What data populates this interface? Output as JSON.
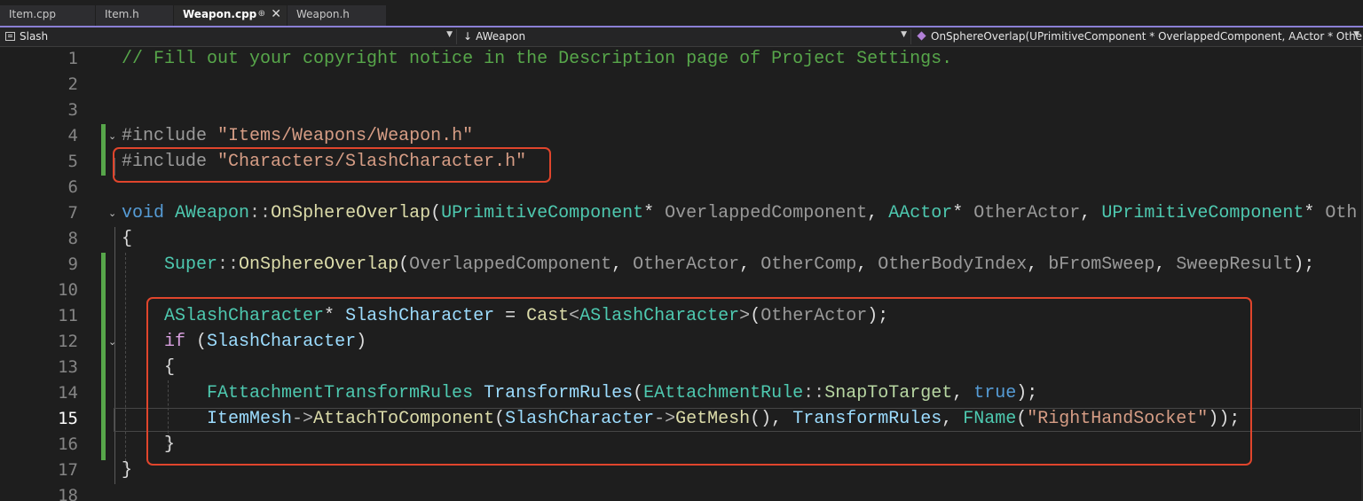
{
  "tabs": [
    {
      "label": "Item.cpp"
    },
    {
      "label": "Item.h"
    },
    {
      "label": "Weapon.cpp"
    },
    {
      "label": "Weapon.h"
    }
  ],
  "nav": {
    "project": "Slash",
    "scope": "AWeapon",
    "member": "OnSphereOverlap(UPrimitiveComponent * OverlappedComponent, AActor * Othe"
  },
  "current_line": 15,
  "lines": [
    {
      "num": "1",
      "tokens": [
        [
          "// Fill out your copyright notice in the Description page of Project Settings.",
          "cm"
        ]
      ]
    },
    {
      "num": "2",
      "tokens": []
    },
    {
      "num": "3",
      "tokens": []
    },
    {
      "num": "4",
      "tokens": [
        [
          "#include ",
          "pp"
        ],
        [
          "\"Items/Weapons/Weapon.h\"",
          "st"
        ]
      ]
    },
    {
      "num": "5",
      "tokens": [
        [
          "#include ",
          "pp"
        ],
        [
          "\"Characters/SlashCharacter.h\"",
          "st"
        ]
      ]
    },
    {
      "num": "6",
      "tokens": []
    },
    {
      "num": "7",
      "tokens": [
        [
          "void",
          "kw"
        ],
        [
          " ",
          ""
        ],
        [
          "AWeapon",
          "ty"
        ],
        [
          "::",
          "op"
        ],
        [
          "OnSphereOverlap",
          "fn"
        ],
        [
          "(",
          ""
        ],
        [
          "UPrimitiveComponent",
          "ty"
        ],
        [
          "* ",
          ""
        ],
        [
          "OverlappedComponent",
          "pm"
        ],
        [
          ", ",
          ""
        ],
        [
          "AActor",
          "ty"
        ],
        [
          "* ",
          ""
        ],
        [
          "OtherActor",
          "pm"
        ],
        [
          ", ",
          ""
        ],
        [
          "UPrimitiveComponent",
          "ty"
        ],
        [
          "* ",
          ""
        ],
        [
          "Oth",
          "pm"
        ]
      ]
    },
    {
      "num": "8",
      "tokens": [
        [
          "{",
          ""
        ]
      ]
    },
    {
      "num": "9",
      "tokens": [
        [
          "    ",
          ""
        ],
        [
          "Super",
          "ty"
        ],
        [
          "::",
          "op"
        ],
        [
          "OnSphereOverlap",
          "fn"
        ],
        [
          "(",
          ""
        ],
        [
          "OverlappedComponent",
          "pm"
        ],
        [
          ", ",
          ""
        ],
        [
          "OtherActor",
          "pm"
        ],
        [
          ", ",
          ""
        ],
        [
          "OtherComp",
          "pm"
        ],
        [
          ", ",
          ""
        ],
        [
          "OtherBodyIndex",
          "pm"
        ],
        [
          ", ",
          ""
        ],
        [
          "bFromSweep",
          "pm"
        ],
        [
          ", ",
          ""
        ],
        [
          "SweepResult",
          "pm"
        ],
        [
          ");",
          ""
        ]
      ]
    },
    {
      "num": "10",
      "tokens": []
    },
    {
      "num": "11",
      "tokens": [
        [
          "    ",
          ""
        ],
        [
          "ASlashCharacter",
          "ty"
        ],
        [
          "* ",
          ""
        ],
        [
          "SlashCharacter",
          "vr"
        ],
        [
          " = ",
          ""
        ],
        [
          "Cast",
          "fn"
        ],
        [
          "<",
          "op"
        ],
        [
          "ASlashCharacter",
          "ty"
        ],
        [
          ">",
          "op"
        ],
        [
          "(",
          ""
        ],
        [
          "OtherActor",
          "pm"
        ],
        [
          ");",
          ""
        ]
      ]
    },
    {
      "num": "12",
      "tokens": [
        [
          "    ",
          ""
        ],
        [
          "if",
          "ct"
        ],
        [
          " (",
          ""
        ],
        [
          "SlashCharacter",
          "vr"
        ],
        [
          ")",
          ""
        ]
      ]
    },
    {
      "num": "13",
      "tokens": [
        [
          "    {",
          ""
        ]
      ]
    },
    {
      "num": "14",
      "tokens": [
        [
          "        ",
          ""
        ],
        [
          "FAttachmentTransformRules",
          "ty"
        ],
        [
          " ",
          ""
        ],
        [
          "TransformRules",
          "vr"
        ],
        [
          "(",
          ""
        ],
        [
          "EAttachmentRule",
          "ty"
        ],
        [
          "::",
          "op"
        ],
        [
          "SnapToTarget",
          "en"
        ],
        [
          ", ",
          ""
        ],
        [
          "true",
          "kw"
        ],
        [
          ");",
          ""
        ]
      ]
    },
    {
      "num": "15",
      "tokens": [
        [
          "        ",
          ""
        ],
        [
          "ItemMesh",
          "vr"
        ],
        [
          "->",
          "op"
        ],
        [
          "AttachToComponent",
          "fn"
        ],
        [
          "(",
          ""
        ],
        [
          "SlashCharacter",
          "vr"
        ],
        [
          "->",
          "op"
        ],
        [
          "GetMesh",
          "fn"
        ],
        [
          "(), ",
          ""
        ],
        [
          "TransformRules",
          "vr"
        ],
        [
          ", ",
          ""
        ],
        [
          "FName",
          "ty"
        ],
        [
          "(",
          ""
        ],
        [
          "\"RightHandSocket\"",
          "st"
        ],
        [
          "));",
          ""
        ]
      ]
    },
    {
      "num": "16",
      "tokens": [
        [
          "    }",
          ""
        ]
      ]
    },
    {
      "num": "17",
      "tokens": [
        [
          "}",
          ""
        ]
      ]
    },
    {
      "num": "18",
      "tokens": []
    }
  ]
}
